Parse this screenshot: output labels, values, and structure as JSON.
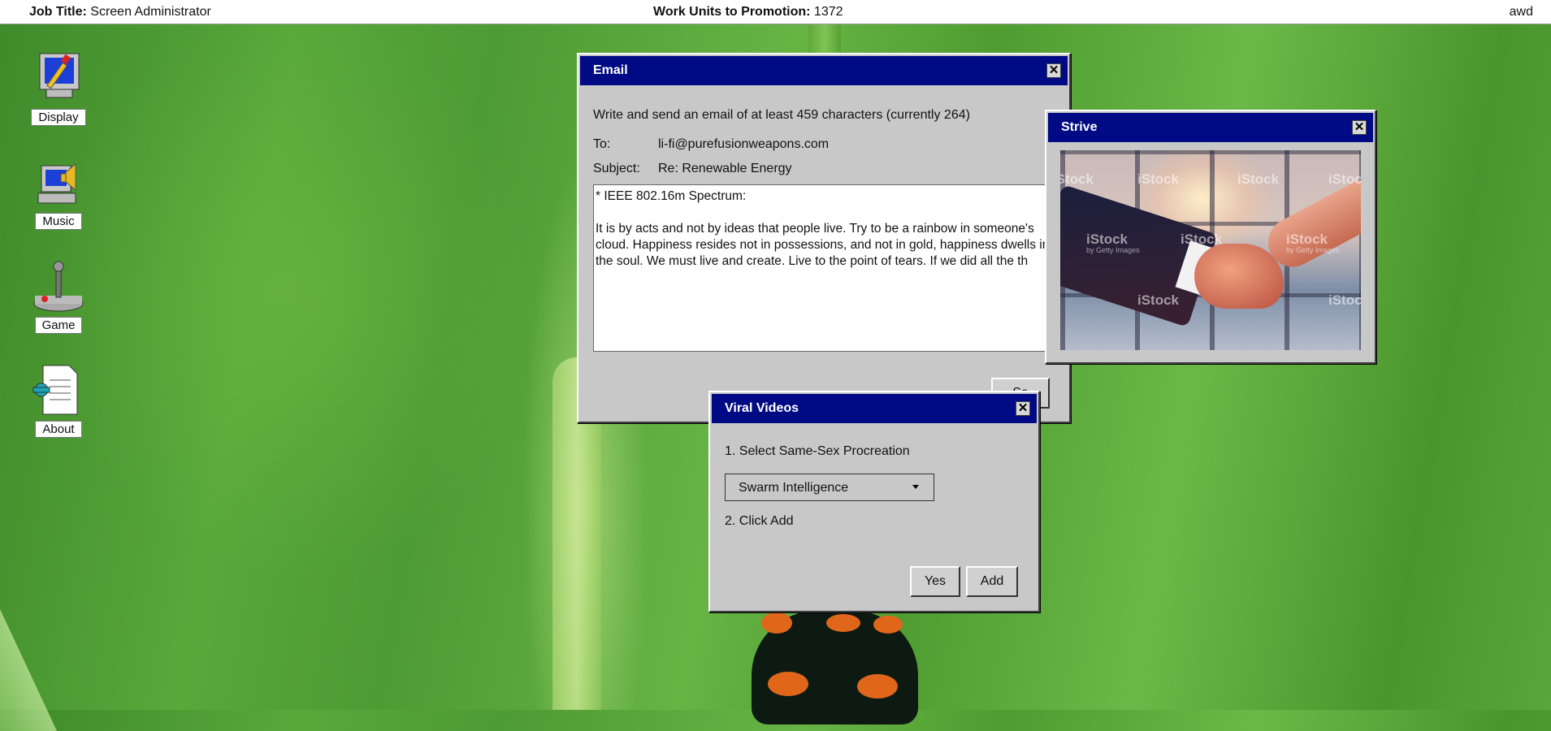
{
  "topbar": {
    "job_title_label": "Job Title:",
    "job_title_value": "Screen Administrator",
    "work_units_label": "Work Units to Promotion:",
    "work_units_value": "1372",
    "user": "awd"
  },
  "desktop": {
    "icons": [
      {
        "label": "Display",
        "icon": "display-settings-icon"
      },
      {
        "label": "Music",
        "icon": "music-speaker-icon"
      },
      {
        "label": "Game",
        "icon": "joystick-icon"
      },
      {
        "label": "About",
        "icon": "about-document-icon"
      }
    ]
  },
  "email_window": {
    "title": "Email",
    "instruction": "Write and send an email of at least 459 characters (currently 264)",
    "to_label": "To:",
    "to_value": "li-fi@purefusionweapons.com",
    "subject_label": "Subject:",
    "subject_value": "Re: Renewable Energy",
    "body_line1": "* IEEE 802.16m Spectrum:",
    "body_text": "It is by acts and not by ideas that people live. Try to be a rainbow in someone's cloud. Happiness resides not in possessions, and not in gold, happiness dwells in the soul. We must live and create. Live to the point of tears. If we did all the th",
    "send_label": "Se"
  },
  "strive_window": {
    "title": "Strive",
    "image_watermark": "iStock",
    "image_subwatermark": "by Getty Images"
  },
  "viral_window": {
    "title": "Viral Videos",
    "step1": "1. Select Same-Sex Procreation",
    "dropdown_value": "Swarm Intelligence",
    "step2": "2. Click Add",
    "yes_label": "Yes",
    "add_label": "Add"
  },
  "colors": {
    "titlebar": "#000a84",
    "window": "#c8c8c8"
  }
}
